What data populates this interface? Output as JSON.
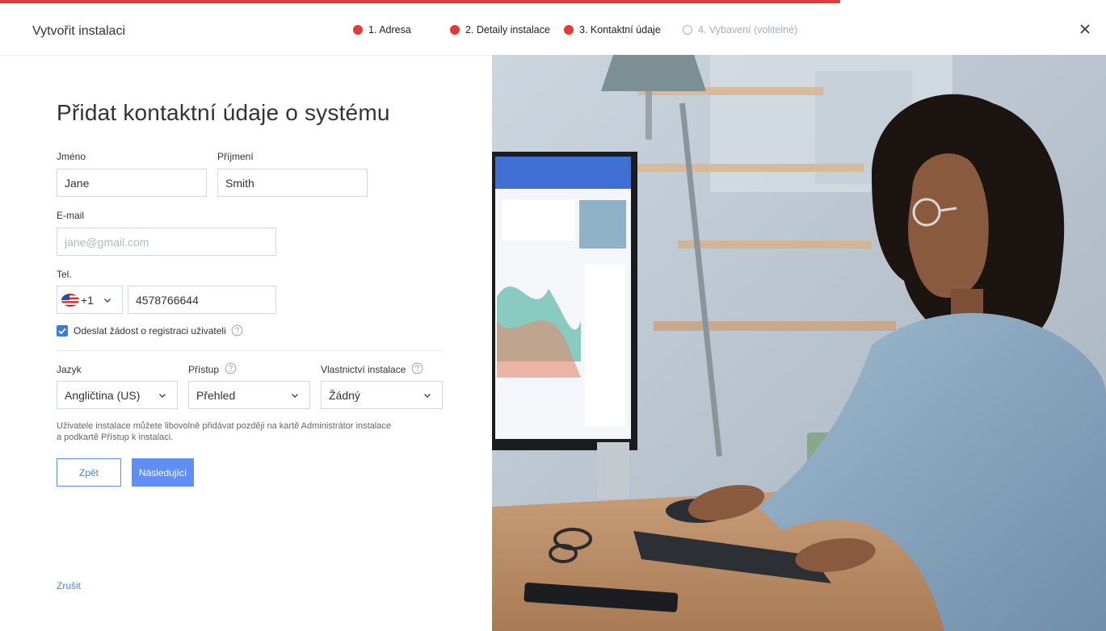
{
  "header": {
    "title": "Vytvořit instalaci",
    "steps": [
      {
        "label": "1. Adresa",
        "status": "done"
      },
      {
        "label": "2. Detaily instalace",
        "status": "done"
      },
      {
        "label": "3. Kontaktní údaje",
        "status": "current"
      },
      {
        "label": "4. Vybavení (volitelné)",
        "status": "pending"
      }
    ],
    "close_icon": "close-icon"
  },
  "form": {
    "title": "Přidat kontaktní údaje o systému",
    "first_name": {
      "label": "Jméno",
      "value": "Jane"
    },
    "last_name": {
      "label": "Příjmení",
      "value": "Smith"
    },
    "email": {
      "label": "E-mail",
      "value": "",
      "placeholder": "jane@gmail.com"
    },
    "phone": {
      "label": "Tel.",
      "country_code": "+1",
      "flag": "us-flag-icon",
      "value": "4578766644"
    },
    "send_request": {
      "label": "Odeslat žádost o registraci uživateli",
      "checked": true
    },
    "language": {
      "label": "Jazyk",
      "value": "Angličtina (US)"
    },
    "access": {
      "label": "Přístup",
      "value": "Přehled"
    },
    "ownership": {
      "label": "Vlastnictví instalace",
      "value": "Žádný"
    },
    "note": "Uživatele instalace můžete libovolně přidávat později na kartě Administrátor instalace a podkartě Přístup k instalaci.",
    "back_label": "Zpět",
    "next_label": "Následující",
    "cancel_label": "Zrušit"
  },
  "colors": {
    "accent_red": "#e53935",
    "primary_blue": "#5f8ff3",
    "link_blue": "#4a7fe8"
  }
}
